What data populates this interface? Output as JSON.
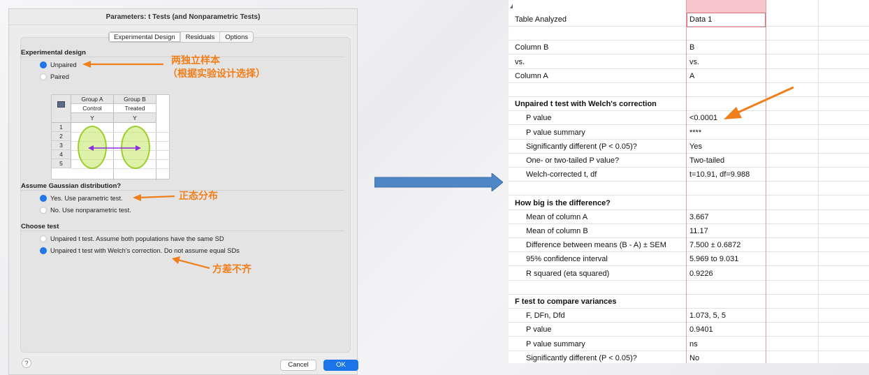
{
  "dialog": {
    "title": "Parameters: t Tests (and Nonparametric Tests)",
    "tabs": [
      "Experimental Design",
      "Residuals",
      "Options"
    ],
    "active_tab": 0,
    "experimental_design": {
      "heading": "Experimental design",
      "options": [
        "Unpaired",
        "Paired"
      ],
      "selected": 0
    },
    "mini_table": {
      "group_headers": [
        "Group A",
        "Group B"
      ],
      "group_names": [
        "Control",
        "Treated"
      ],
      "y_labels": [
        "Y",
        "Y"
      ],
      "row_numbers": [
        "1",
        "2",
        "3",
        "4",
        "5"
      ]
    },
    "gaussian": {
      "heading": "Assume Gaussian distribution?",
      "options": [
        "Yes. Use parametric test.",
        "No. Use nonparametric test."
      ],
      "selected": 0
    },
    "choose_test": {
      "heading": "Choose test",
      "options": [
        "Unpaired t test. Assume both populations have the same SD",
        "Unpaired t test with Welch's correction. Do not assume equal SDs"
      ],
      "selected": 1
    },
    "help_label": "?",
    "cancel_label": "Cancel",
    "ok_label": "OK"
  },
  "annotations": {
    "unpaired_line1": "两独立样本",
    "unpaired_line2": "（根据实验设计选择）",
    "gaussian": "正态分布",
    "variance": "方差不齐",
    "color": "#f07f1b"
  },
  "results": {
    "rows": [
      {
        "label": "Table Analyzed",
        "value": "Data 1",
        "style": "plain"
      },
      {
        "label": "",
        "value": "",
        "style": "plain"
      },
      {
        "label": "Column B",
        "value": "B",
        "style": "plain"
      },
      {
        "label": "vs.",
        "value": "vs.",
        "style": "plain"
      },
      {
        "label": "Column A",
        "value": "A",
        "style": "plain"
      },
      {
        "label": "",
        "value": "",
        "style": "plain"
      },
      {
        "label": "Unpaired t test with Welch's correction",
        "value": "",
        "style": "bold"
      },
      {
        "label": "P value",
        "value": "<0.0001",
        "style": "indent"
      },
      {
        "label": "P value summary",
        "value": "****",
        "style": "indent"
      },
      {
        "label": "Significantly different (P < 0.05)?",
        "value": "Yes",
        "style": "indent"
      },
      {
        "label": "One- or two-tailed P value?",
        "value": "Two-tailed",
        "style": "indent"
      },
      {
        "label": "Welch-corrected  t, df",
        "value": "t=10.91, df=9.988",
        "style": "indent"
      },
      {
        "label": "",
        "value": "",
        "style": "plain"
      },
      {
        "label": "How big is the difference?",
        "value": "",
        "style": "bold"
      },
      {
        "label": "Mean of column A",
        "value": "3.667",
        "style": "indent"
      },
      {
        "label": "Mean of column B",
        "value": "11.17",
        "style": "indent"
      },
      {
        "label": "Difference between means (B - A) ± SEM",
        "value": "7.500 ± 0.6872",
        "style": "indent"
      },
      {
        "label": "95% confidence interval",
        "value": "5.969 to 9.031",
        "style": "indent"
      },
      {
        "label": "R squared (eta squared)",
        "value": "0.9226",
        "style": "indent"
      },
      {
        "label": "",
        "value": "",
        "style": "plain"
      },
      {
        "label": "F test to compare variances",
        "value": "",
        "style": "bold"
      },
      {
        "label": "F, DFn, Dfd",
        "value": "1.073, 5, 5",
        "style": "indent"
      },
      {
        "label": "P value",
        "value": "0.9401",
        "style": "indent"
      },
      {
        "label": "P value summary",
        "value": "ns",
        "style": "indent"
      },
      {
        "label": "Significantly different (P < 0.05)?",
        "value": "No",
        "style": "indent"
      }
    ]
  },
  "colors": {
    "accent_blue": "#1b74e8",
    "annotation_orange": "#f07f1b",
    "flow_arrow": "#4f86c6",
    "oval_green": "#9ccf2b",
    "arrow_purple": "#8a2be2",
    "sheet_red": "#e49aa2"
  }
}
